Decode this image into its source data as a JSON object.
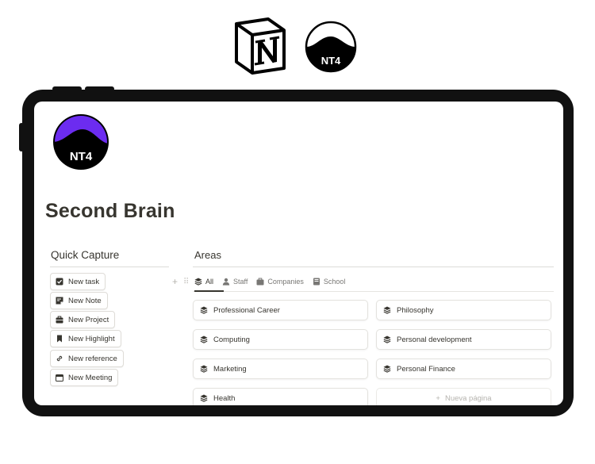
{
  "page": {
    "title": "Second Brain"
  },
  "branding": {
    "notion_icon": "notion-logo-icon",
    "nt4_icon": "nt4-logo-icon",
    "nt4_text": "NT4",
    "nt4_color": "#6c2cf0"
  },
  "quick_capture": {
    "title": "Quick Capture",
    "buttons": [
      {
        "label": "New task",
        "icon": "checkbox-icon"
      },
      {
        "label": "New Note",
        "icon": "note-icon"
      },
      {
        "label": "New Project",
        "icon": "briefcase-icon"
      },
      {
        "label": "New Highlight",
        "icon": "bookmark-icon"
      },
      {
        "label": "New reference",
        "icon": "link-icon"
      },
      {
        "label": "New Meeting",
        "icon": "calendar-icon"
      }
    ]
  },
  "areas": {
    "title": "Areas",
    "tabs": [
      {
        "label": "All",
        "icon": "stack-icon",
        "active": true
      },
      {
        "label": "Staff",
        "icon": "person-icon",
        "active": false
      },
      {
        "label": "Companies",
        "icon": "briefcase-icon",
        "active": false
      },
      {
        "label": "School",
        "icon": "book-icon",
        "active": false
      }
    ],
    "cards": [
      {
        "label": "Professional Career"
      },
      {
        "label": "Philosophy"
      },
      {
        "label": "Computing"
      },
      {
        "label": "Personal development"
      },
      {
        "label": "Marketing"
      },
      {
        "label": "Personal Finance"
      },
      {
        "label": "Health"
      }
    ],
    "new_page_label": "Nueva página",
    "new_page_plus": "+"
  }
}
